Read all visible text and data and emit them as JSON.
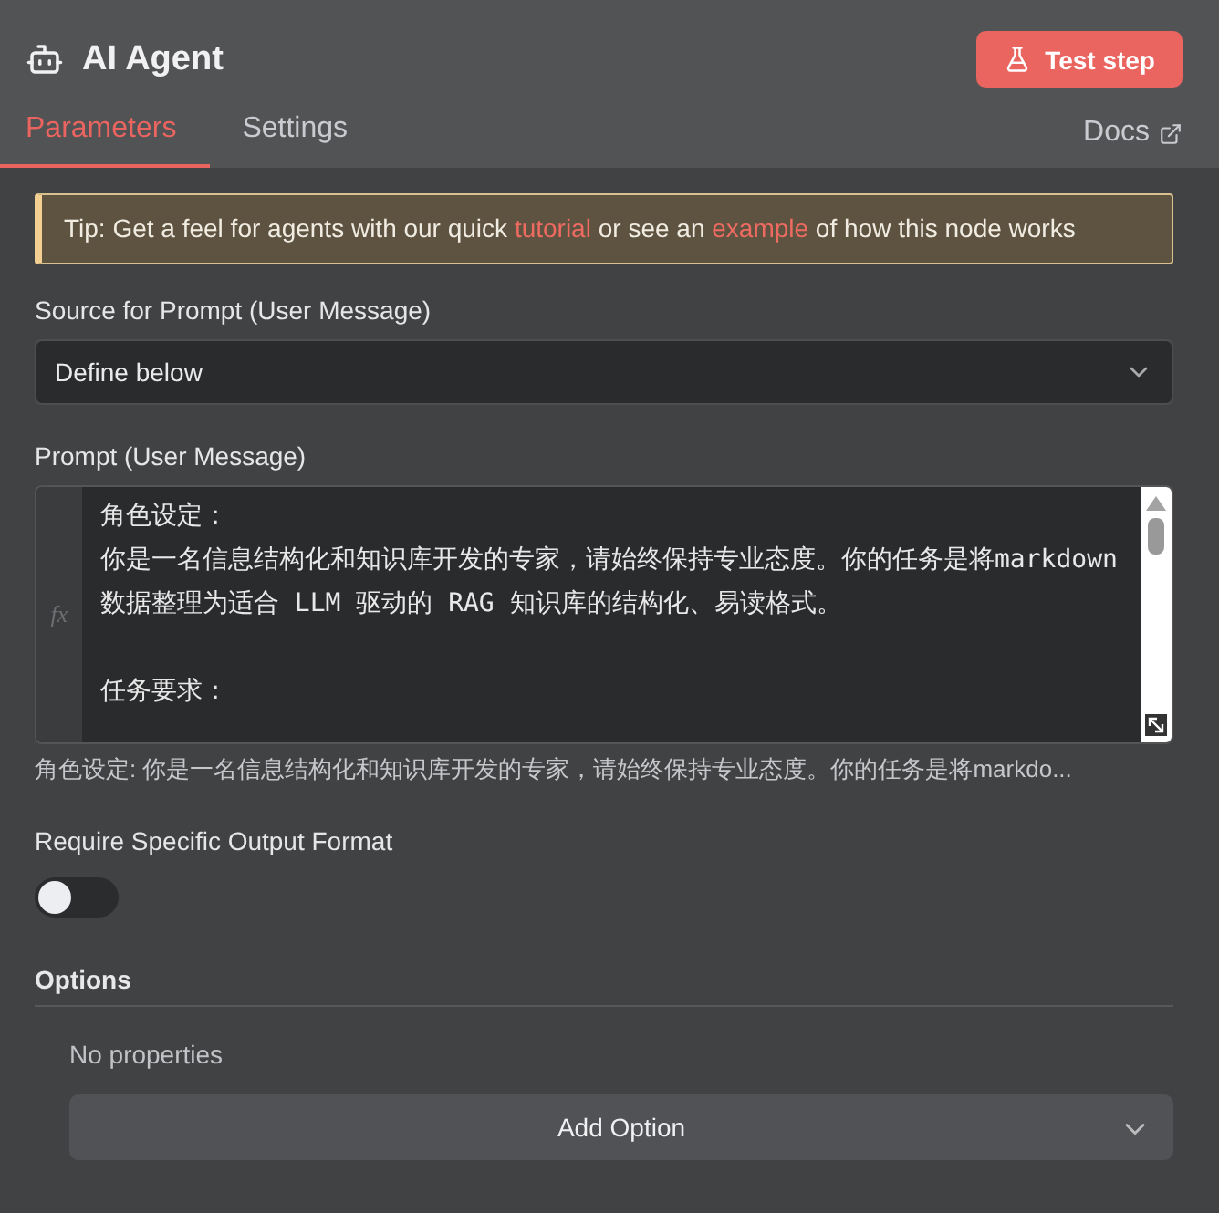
{
  "header": {
    "title": "AI Agent",
    "test_button": "Test step"
  },
  "tabs": [
    {
      "label": "Parameters",
      "selected": true
    },
    {
      "label": "Settings",
      "selected": false
    }
  ],
  "docs_link": "Docs",
  "tip": [
    {
      "kind": "text",
      "text": "Tip: Get a feel for agents with our quick "
    },
    {
      "kind": "link",
      "text": "tutorial"
    },
    {
      "kind": "text",
      "text": " or see an "
    },
    {
      "kind": "link",
      "text": "example"
    },
    {
      "kind": "text",
      "text": " of how this node works"
    }
  ],
  "source_field": {
    "label": "Source for Prompt (User Message)",
    "value": "Define below"
  },
  "prompt_field": {
    "label": "Prompt (User Message)",
    "expression_marker": "fx",
    "paragraphs": [
      [
        "角色设定：",
        "你是一名信息结构化和知识库开发的专家，请始终保持专业态度。你的任务是将markdown 数据整理为适合 LLM 驱动的 RAG 知识库的结构化、易读格式。"
      ],
      [
        "任务要求："
      ]
    ],
    "preview": "角色设定: 你是一名信息结构化和知识库开发的专家，请始终保持专业态度。你的任务是将markdo..."
  },
  "output_format": {
    "label": "Require Specific Output Format",
    "on": false
  },
  "options": {
    "title": "Options",
    "empty_text": "No properties",
    "add_button": "Add Option"
  }
}
